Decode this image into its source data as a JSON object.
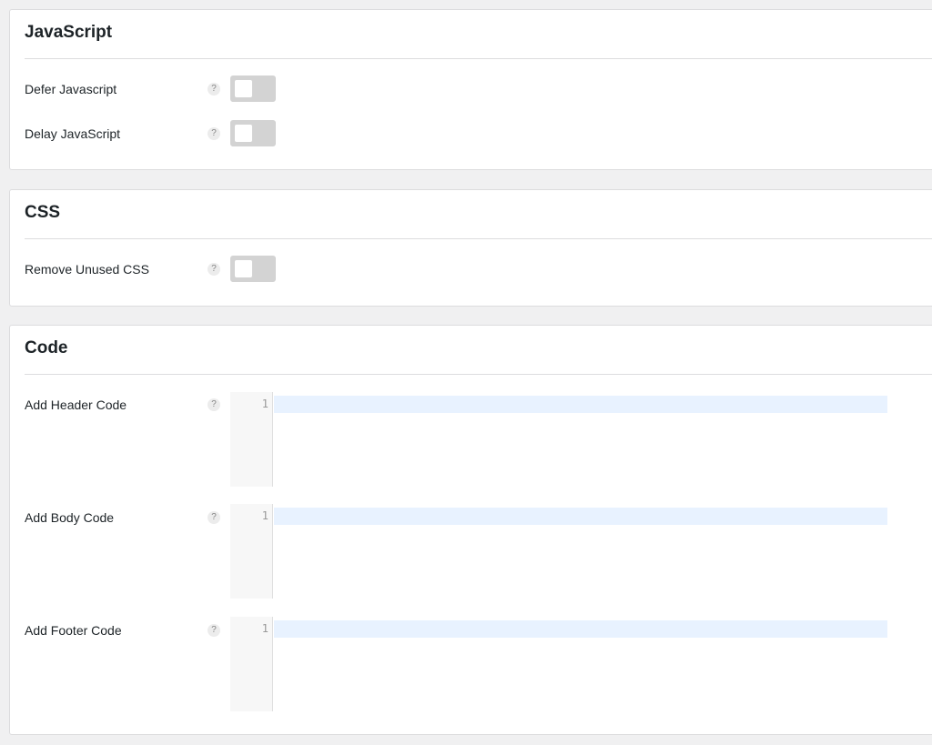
{
  "sections": {
    "javascript": {
      "title": "JavaScript",
      "rows": [
        {
          "label": "Defer Javascript",
          "help": "?",
          "enabled": false
        },
        {
          "label": "Delay JavaScript",
          "help": "?",
          "enabled": false
        }
      ]
    },
    "css": {
      "title": "CSS",
      "rows": [
        {
          "label": "Remove Unused CSS",
          "help": "?",
          "enabled": false
        }
      ]
    },
    "code": {
      "title": "Code",
      "rows": [
        {
          "label": "Add Header Code",
          "help": "?",
          "line_number": "1",
          "value": ""
        },
        {
          "label": "Add Body Code",
          "help": "?",
          "line_number": "1",
          "value": ""
        },
        {
          "label": "Add Footer Code",
          "help": "?",
          "line_number": "1",
          "value": ""
        }
      ]
    }
  },
  "colors": {
    "page_background": "#f0f0f1",
    "card_background": "#ffffff",
    "toggle_off": "#d3d3d3",
    "active_line": "#e8f2ff"
  }
}
